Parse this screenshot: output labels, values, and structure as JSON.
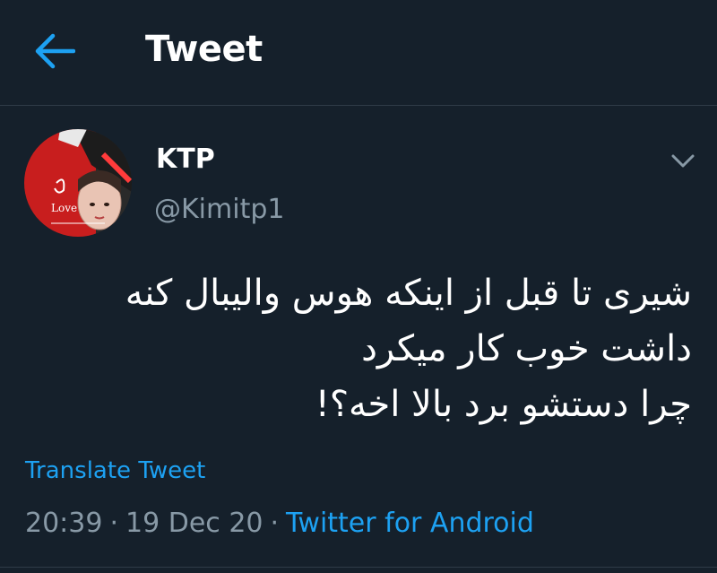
{
  "header": {
    "back_icon": "arrow-left-icon",
    "title": "Tweet"
  },
  "tweet": {
    "author": {
      "name": "KTP",
      "handle": "@Kimitp1",
      "avatar_text": "Love"
    },
    "more_icon": "chevron-down-icon",
    "lines": [
      "شیری تا قبل از اینکه هوس والیبال کنه",
      "داشت خوب کار میکرد",
      "چرا دستشو برد بالا اخه؟!"
    ],
    "translate_label": "Translate Tweet",
    "time": "20:39",
    "date": "19 Dec 20",
    "separator": "·",
    "source": "Twitter for Android"
  },
  "colors": {
    "background": "#15202b",
    "accent": "#1da1f2",
    "secondary_text": "#8899a6",
    "divider": "#2f3b47"
  }
}
